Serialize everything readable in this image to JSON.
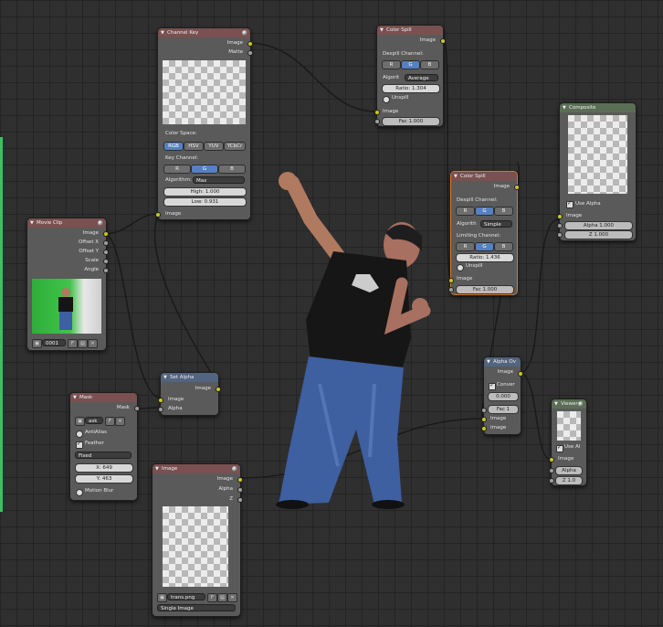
{
  "nodes": {
    "channel_key": {
      "title": "Channel Key",
      "outputs": [
        "Image",
        "Matte"
      ],
      "color_space_label": "Color Space:",
      "color_spaces": [
        "RGB",
        "HSV",
        "YUV",
        "YCbCr"
      ],
      "key_channel_label": "Key Channel:",
      "channels": [
        "R",
        "G",
        "B"
      ],
      "algorithm_label": "Algorithm:",
      "algorithm": "Max",
      "high": "High: 1.000",
      "low": "Low: 0.931",
      "input": "Image"
    },
    "color_spill_1": {
      "title": "Color Spill",
      "output": "Image",
      "despill_label": "Despill Channel:",
      "channels": [
        "R",
        "G",
        "B"
      ],
      "algorithm_label": "Algorit",
      "algorithm": "Average",
      "ratio": "Ratio: 1.304",
      "unspill": "Unspill",
      "input": "Image",
      "fac": "Fac 1.000"
    },
    "color_spill_2": {
      "title": "Color Spill",
      "output": "Image",
      "despill_label": "Despill Channel:",
      "channels": [
        "R",
        "G",
        "B"
      ],
      "algorithm_label": "Algorith",
      "algorithm": "Simple",
      "limiting_label": "Limiting Channel:",
      "limit_channels": [
        "R",
        "G",
        "B"
      ],
      "ratio": "Ratio: 1.436",
      "unspill": "Unspill",
      "input": "Image",
      "fac": "Fac 1.000"
    },
    "composite": {
      "title": "Composite",
      "use_alpha": "Use Alpha",
      "inputs": [
        "Image",
        "Alpha 1.000",
        "Z 1.000"
      ]
    },
    "movie_clip": {
      "title": "Movie Clip",
      "outputs": [
        "Image",
        "Offset X",
        "Offset Y",
        "Scale",
        "Angle"
      ],
      "clip_name": "0001"
    },
    "set_alpha": {
      "title": "Set Alpha",
      "output": "Image",
      "inputs": [
        "Image",
        "Alpha"
      ]
    },
    "mask": {
      "title": "Mask",
      "output": "Mask",
      "mask_name": "ask",
      "anti_alias": "AntiAlias",
      "feather": "Feather",
      "size_mode": "Fixed",
      "x": "X: 649",
      "y": "Y: 463",
      "motion_blur": "Motion Blur"
    },
    "alpha_over": {
      "title": "Alpha Ov",
      "output": "Image",
      "convert": "Conver",
      "premul": "0.000",
      "fac": "Fac 1",
      "inputs": [
        "Image",
        "Image"
      ]
    },
    "viewer": {
      "title": "Viewer",
      "use_alpha": "Use Al",
      "inputs": [
        "Image",
        "Alpha",
        "Z 1.0"
      ]
    },
    "image": {
      "title": "Image",
      "outputs": [
        "Image",
        "Alpha",
        "Z"
      ],
      "file": "trans.png",
      "source": "Single Image",
      "frame_flag": "F"
    }
  },
  "colors": {
    "background": "#2f2f2f",
    "grid": "#242424",
    "socket_color": "#c7c729",
    "socket_value": "#a0a0a0",
    "selected_outline": "#d07a30",
    "active_button": "#5680c2"
  }
}
